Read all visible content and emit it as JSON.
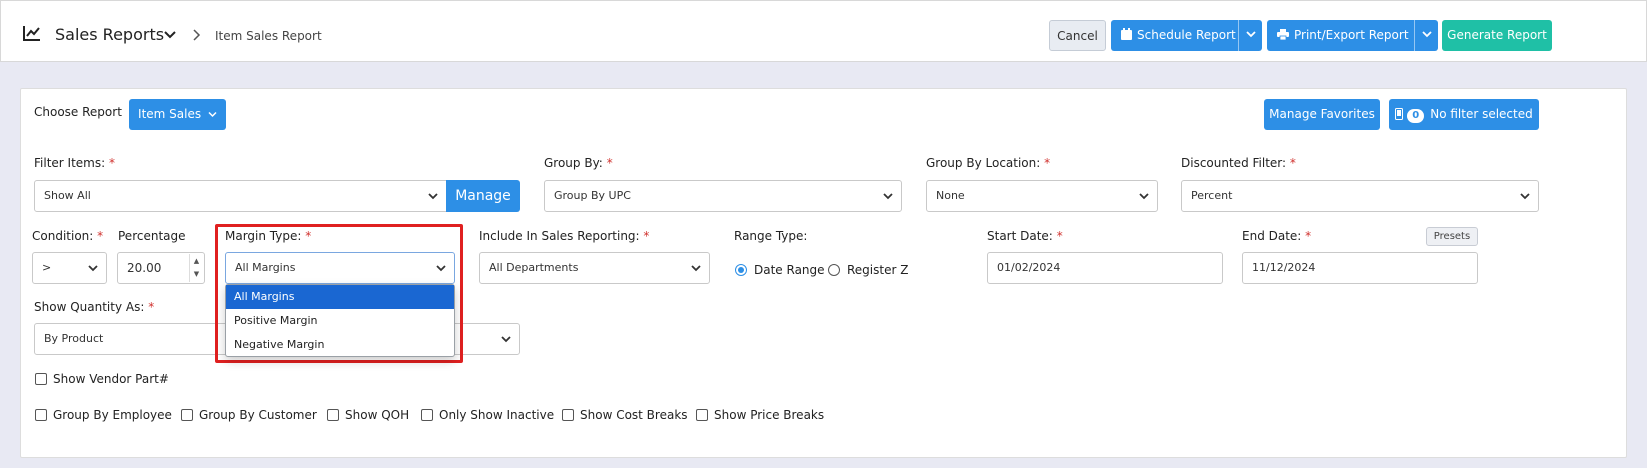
{
  "header": {
    "title": "Sales Reports",
    "subpage": "Item Sales Report",
    "cancel_label": "Cancel",
    "schedule_label": "Schedule Report",
    "print_label": "Print/Export Report",
    "generate_label": "Generate Report"
  },
  "toolbar": {
    "choose_report_label": "Choose Report",
    "report_value": "Item Sales",
    "manage_favorites_label": "Manage Favorites",
    "filter_count": "0",
    "filter_status": "No filter selected"
  },
  "form": {
    "filter_items": {
      "label": "Filter Items:",
      "value": "Show All",
      "manage_label": "Manage"
    },
    "group_by": {
      "label": "Group By:",
      "value": "Group By UPC"
    },
    "group_by_location": {
      "label": "Group By Location:",
      "value": "None"
    },
    "discounted_filter": {
      "label": "Discounted Filter:",
      "value": "Percent"
    },
    "condition": {
      "label": "Condition:",
      "value": ">"
    },
    "percentage": {
      "label": "Percentage",
      "value": "20.00"
    },
    "margin_type": {
      "label": "Margin Type:",
      "value": "All Margins",
      "options": [
        "All Margins",
        "Positive Margin",
        "Negative Margin"
      ]
    },
    "include_sales": {
      "label": "Include In Sales Reporting:",
      "value": "All Departments"
    },
    "range_type": {
      "label": "Range Type:",
      "option_1": "Date Range",
      "option_2": "Register Z"
    },
    "start_date": {
      "label": "Start Date:",
      "value": "01/02/2024"
    },
    "end_date": {
      "label": "End Date:",
      "value": "11/12/2024",
      "presets_label": "Presets"
    },
    "show_quantity": {
      "label": "Show Quantity As:",
      "value": "By Product"
    },
    "required_mark": "*"
  },
  "checkboxes": {
    "vendor_part": "Show Vendor Part#",
    "group_employee": "Group By Employee",
    "group_customer": "Group By Customer",
    "show_qoh": "Show QOH",
    "only_inactive": "Only Show Inactive",
    "cost_breaks": "Show Cost Breaks",
    "price_breaks": "Show Price Breaks"
  },
  "colors": {
    "primary_blue": "#2d8fe6",
    "teal": "#1fc0a6",
    "highlight_red": "#e02020",
    "selected_option": "#1a67d2"
  }
}
